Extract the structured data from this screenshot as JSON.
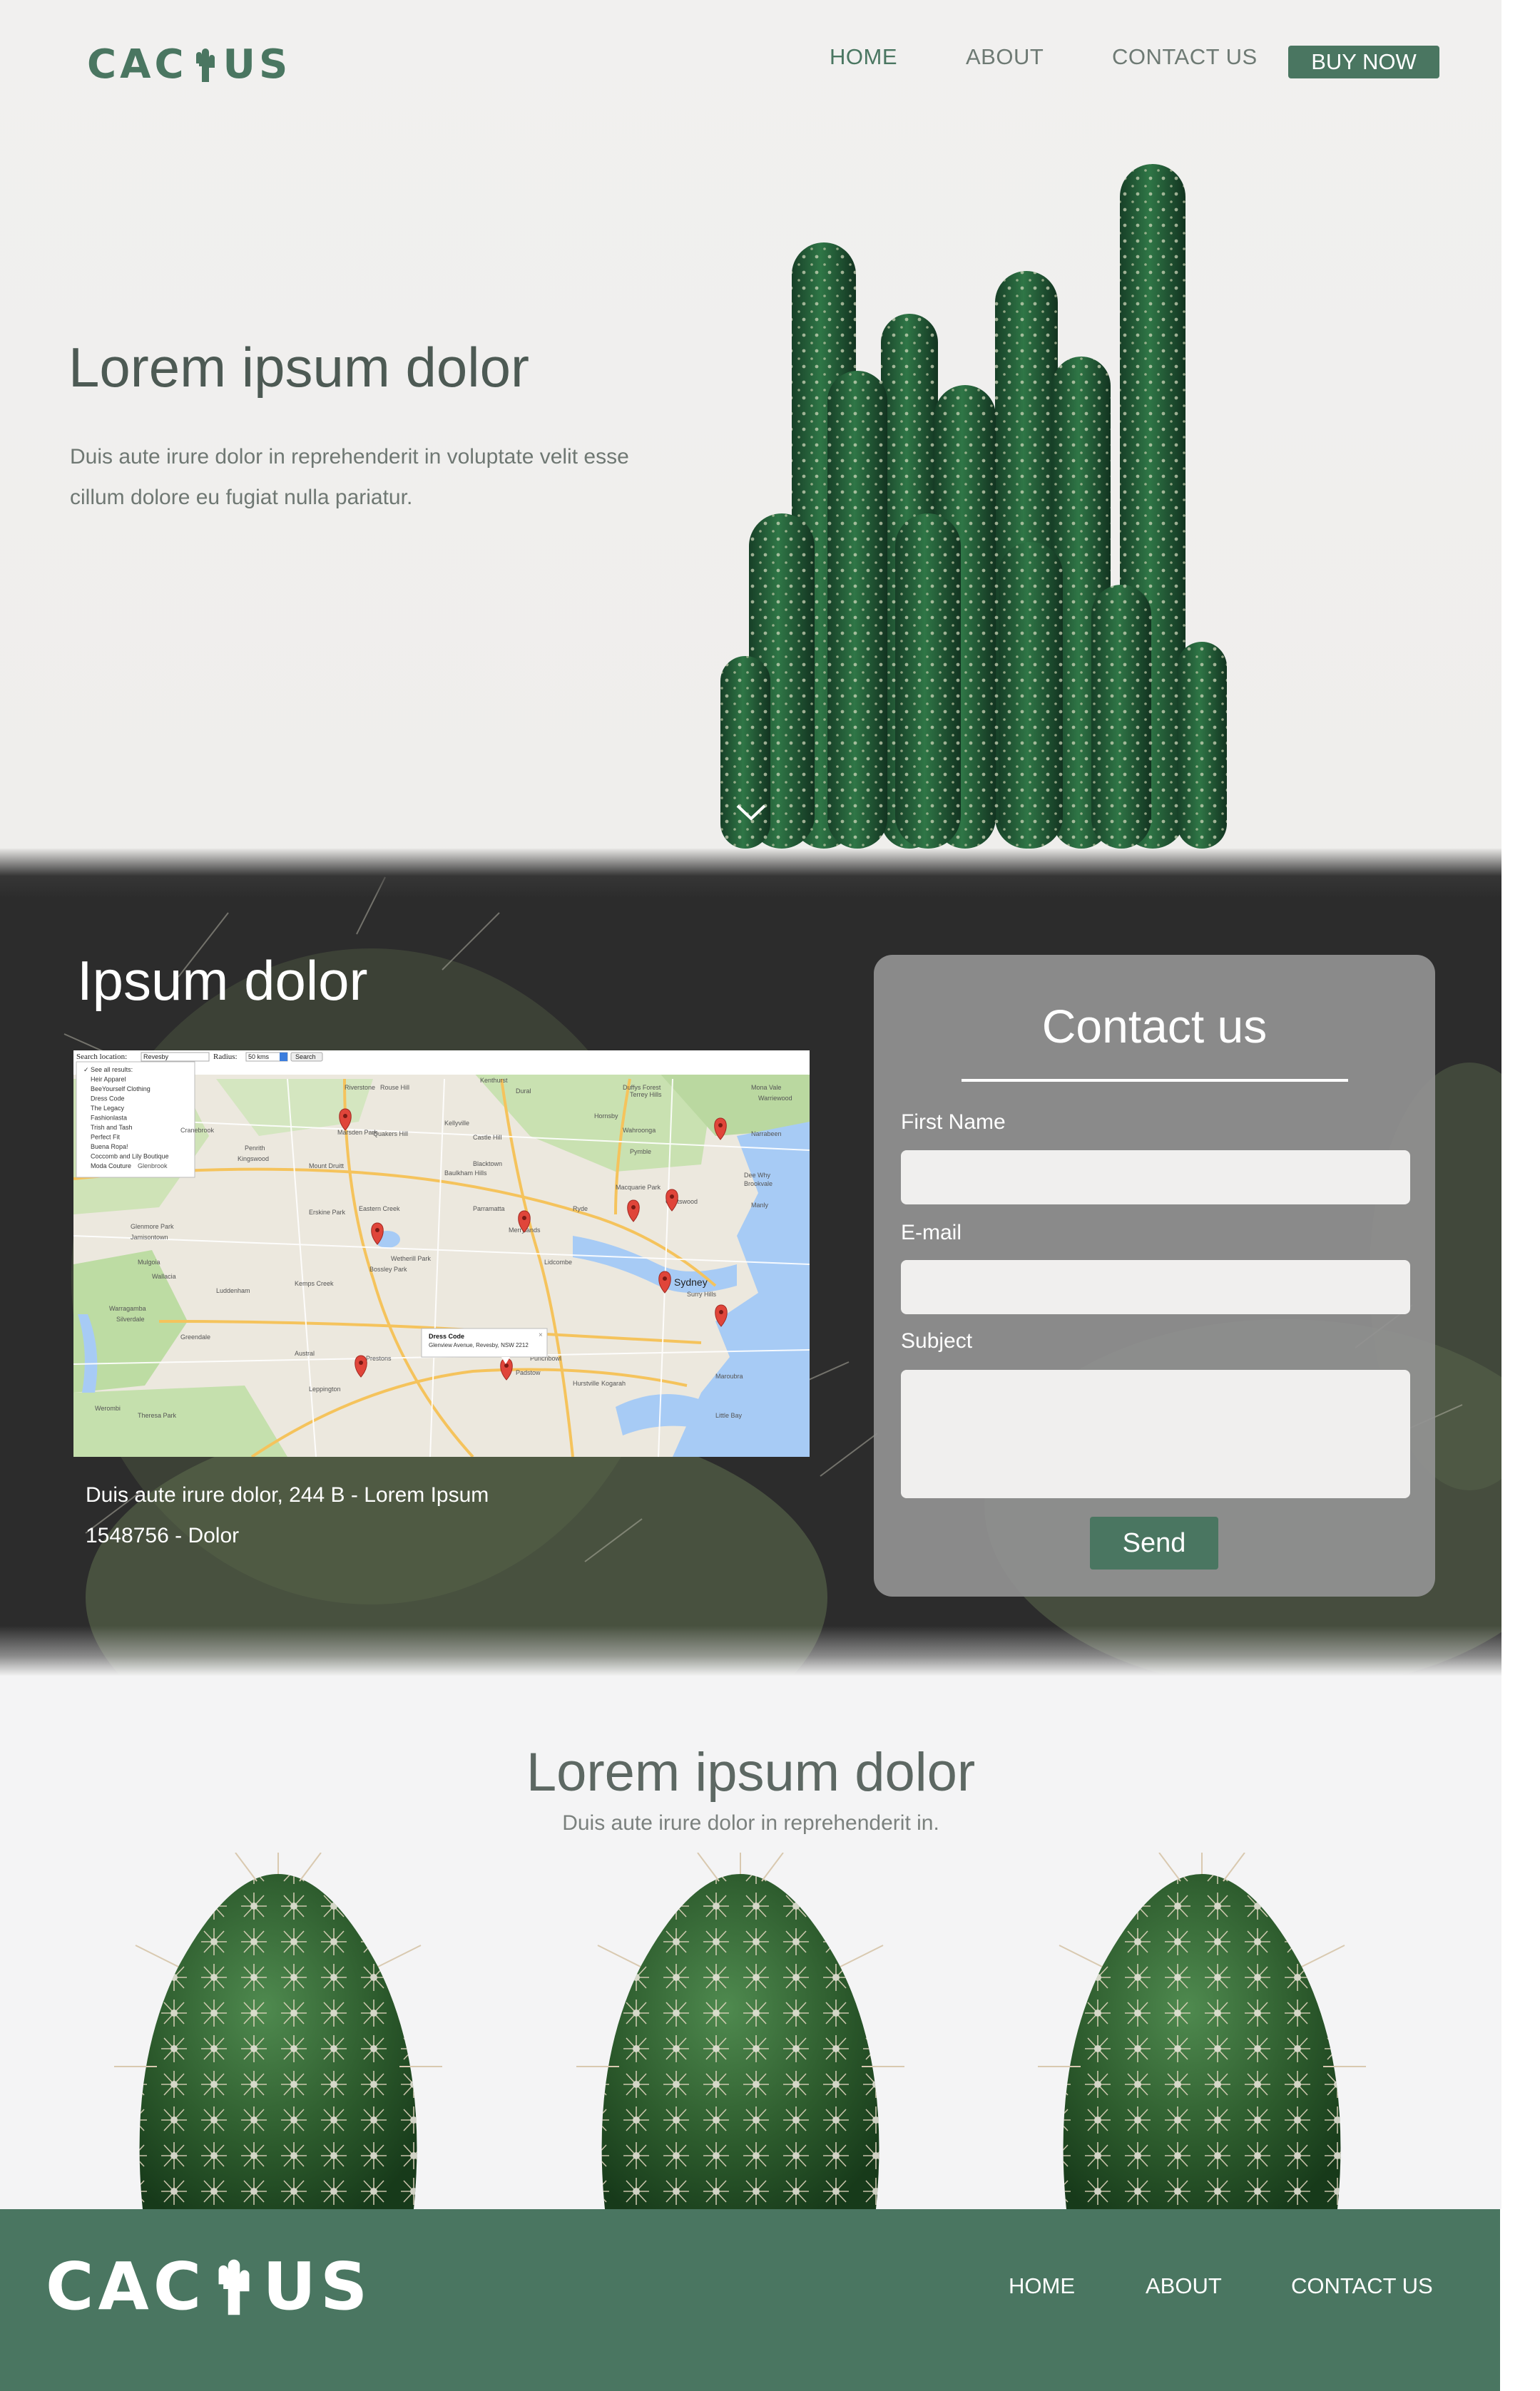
{
  "header": {
    "logo_left": "CAC",
    "logo_right": "US",
    "nav": {
      "home": "HOME",
      "about": "ABOUT",
      "contact": "CONTACT US",
      "buy": "BUY NOW"
    }
  },
  "hero": {
    "title": "Lorem ipsum dolor",
    "subtitle_line1": "Duis aute irure dolor in reprehenderit in voluptate velit esse",
    "subtitle_line2": "cillum dolore eu fugiat nulla pariatur."
  },
  "contact_section": {
    "title": "Ipsum dolor",
    "address_line1": "Duis aute irure dolor, 244 B - Lorem Ipsum",
    "address_line2": "1548756 - Dolor",
    "map": {
      "search_label": "Search location:",
      "search_value": "Revesby",
      "radius_label": "Radius:",
      "radius_value": "50 kms",
      "search_button": "Search",
      "results": [
        "See all results:",
        "Heir Apparel",
        "BeeYourself Clothing",
        "Dress Code",
        "The Legacy",
        "Fashionlasta",
        "Trish and Tash",
        "Perfect Fit",
        "Buena Ropa!",
        "Coccomb and Lily Boutique",
        "Moda Couture"
      ],
      "popup_title": "Dress Code",
      "popup_address": "Glenview Avenue, Revesby, NSW 2212",
      "places": [
        "Riverstone",
        "Rouse Hill",
        "Kellyville",
        "Castle Hill",
        "Hornsby",
        "Wahroonga",
        "Pymble",
        "Marsden Park",
        "Quakers Hill",
        "Blacktown",
        "Baulkham Hills",
        "Parramatta",
        "Macquarie Park",
        "Chatswood",
        "Sydney",
        "Liverpool",
        "Bankstown",
        "Penrith",
        "Kingswood",
        "Glenbrook",
        "Mount Druitt",
        "Eastern Creek",
        "Erskine Park",
        "Wetherill Park",
        "Bossley Park",
        "Kemps Creek",
        "Luddenham",
        "Mulgoia",
        "Wallacia",
        "Greendale",
        "Austral",
        "Prestons",
        "Leppington",
        "Padstow",
        "Hurstville",
        "Kogarah",
        "Maroubra",
        "Surry Hills",
        "Ryde",
        "Merrylands",
        "Lidcombe",
        "Punchbowl",
        "Manly",
        "Dee Why",
        "Brookvale",
        "Duffys Forest",
        "Terrey Hills",
        "Mona Vale",
        "Warriewood",
        "Narrabeen",
        "Kenthurst",
        "Dural",
        "Glenmore Park",
        "Jamisontown",
        "Cranebrook",
        "Warragamba",
        "Silverdale",
        "Theresa Park",
        "Werombi",
        "Little Bay"
      ]
    },
    "form": {
      "title": "Contact us",
      "first_name_label": "First Name",
      "email_label": "E-mail",
      "subject_label": "Subject",
      "send_label": "Send"
    }
  },
  "products": {
    "title": "Lorem ipsum dolor",
    "subtitle": "Duis aute irure dolor in reprehenderit in."
  },
  "footer": {
    "logo_left": "CAC",
    "logo_right": "US",
    "nav": {
      "home": "HOME",
      "about": "ABOUT",
      "contact": "CONTACT US"
    }
  },
  "colors": {
    "brand_green": "#4a7661",
    "hero_bg": "#efeeec",
    "dark_section": "#2c2c2c",
    "form_panel": "#929292",
    "map_water": "#a7cbf5",
    "map_pin": "#e0453a"
  },
  "icons": [
    "cactus-logo-icon",
    "chevron-down-icon",
    "map-pin-icon"
  ]
}
